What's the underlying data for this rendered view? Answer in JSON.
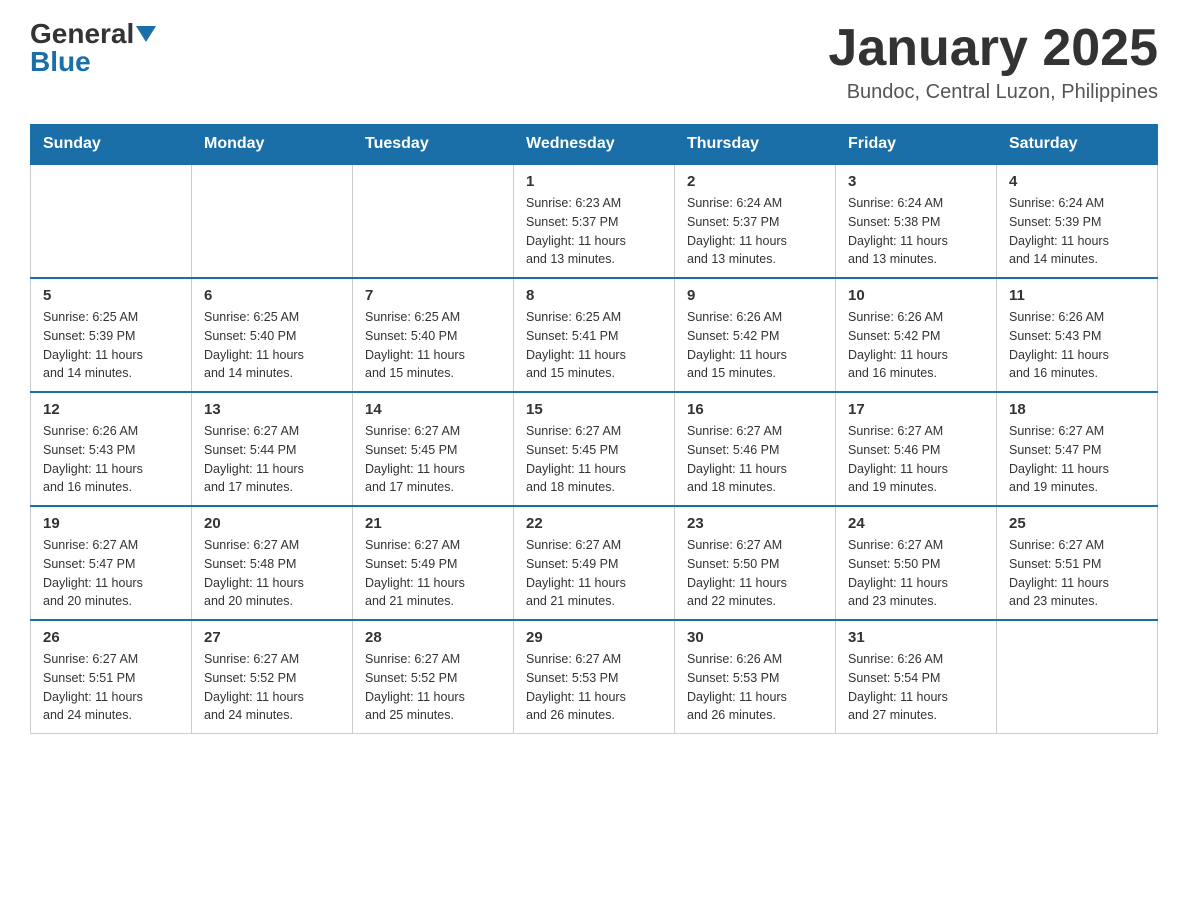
{
  "header": {
    "logo_general": "General",
    "logo_blue": "Blue",
    "month_title": "January 2025",
    "location": "Bundoc, Central Luzon, Philippines"
  },
  "days_of_week": [
    "Sunday",
    "Monday",
    "Tuesday",
    "Wednesday",
    "Thursday",
    "Friday",
    "Saturday"
  ],
  "weeks": [
    [
      {
        "day": "",
        "info": ""
      },
      {
        "day": "",
        "info": ""
      },
      {
        "day": "",
        "info": ""
      },
      {
        "day": "1",
        "info": "Sunrise: 6:23 AM\nSunset: 5:37 PM\nDaylight: 11 hours\nand 13 minutes."
      },
      {
        "day": "2",
        "info": "Sunrise: 6:24 AM\nSunset: 5:37 PM\nDaylight: 11 hours\nand 13 minutes."
      },
      {
        "day": "3",
        "info": "Sunrise: 6:24 AM\nSunset: 5:38 PM\nDaylight: 11 hours\nand 13 minutes."
      },
      {
        "day": "4",
        "info": "Sunrise: 6:24 AM\nSunset: 5:39 PM\nDaylight: 11 hours\nand 14 minutes."
      }
    ],
    [
      {
        "day": "5",
        "info": "Sunrise: 6:25 AM\nSunset: 5:39 PM\nDaylight: 11 hours\nand 14 minutes."
      },
      {
        "day": "6",
        "info": "Sunrise: 6:25 AM\nSunset: 5:40 PM\nDaylight: 11 hours\nand 14 minutes."
      },
      {
        "day": "7",
        "info": "Sunrise: 6:25 AM\nSunset: 5:40 PM\nDaylight: 11 hours\nand 15 minutes."
      },
      {
        "day": "8",
        "info": "Sunrise: 6:25 AM\nSunset: 5:41 PM\nDaylight: 11 hours\nand 15 minutes."
      },
      {
        "day": "9",
        "info": "Sunrise: 6:26 AM\nSunset: 5:42 PM\nDaylight: 11 hours\nand 15 minutes."
      },
      {
        "day": "10",
        "info": "Sunrise: 6:26 AM\nSunset: 5:42 PM\nDaylight: 11 hours\nand 16 minutes."
      },
      {
        "day": "11",
        "info": "Sunrise: 6:26 AM\nSunset: 5:43 PM\nDaylight: 11 hours\nand 16 minutes."
      }
    ],
    [
      {
        "day": "12",
        "info": "Sunrise: 6:26 AM\nSunset: 5:43 PM\nDaylight: 11 hours\nand 16 minutes."
      },
      {
        "day": "13",
        "info": "Sunrise: 6:27 AM\nSunset: 5:44 PM\nDaylight: 11 hours\nand 17 minutes."
      },
      {
        "day": "14",
        "info": "Sunrise: 6:27 AM\nSunset: 5:45 PM\nDaylight: 11 hours\nand 17 minutes."
      },
      {
        "day": "15",
        "info": "Sunrise: 6:27 AM\nSunset: 5:45 PM\nDaylight: 11 hours\nand 18 minutes."
      },
      {
        "day": "16",
        "info": "Sunrise: 6:27 AM\nSunset: 5:46 PM\nDaylight: 11 hours\nand 18 minutes."
      },
      {
        "day": "17",
        "info": "Sunrise: 6:27 AM\nSunset: 5:46 PM\nDaylight: 11 hours\nand 19 minutes."
      },
      {
        "day": "18",
        "info": "Sunrise: 6:27 AM\nSunset: 5:47 PM\nDaylight: 11 hours\nand 19 minutes."
      }
    ],
    [
      {
        "day": "19",
        "info": "Sunrise: 6:27 AM\nSunset: 5:47 PM\nDaylight: 11 hours\nand 20 minutes."
      },
      {
        "day": "20",
        "info": "Sunrise: 6:27 AM\nSunset: 5:48 PM\nDaylight: 11 hours\nand 20 minutes."
      },
      {
        "day": "21",
        "info": "Sunrise: 6:27 AM\nSunset: 5:49 PM\nDaylight: 11 hours\nand 21 minutes."
      },
      {
        "day": "22",
        "info": "Sunrise: 6:27 AM\nSunset: 5:49 PM\nDaylight: 11 hours\nand 21 minutes."
      },
      {
        "day": "23",
        "info": "Sunrise: 6:27 AM\nSunset: 5:50 PM\nDaylight: 11 hours\nand 22 minutes."
      },
      {
        "day": "24",
        "info": "Sunrise: 6:27 AM\nSunset: 5:50 PM\nDaylight: 11 hours\nand 23 minutes."
      },
      {
        "day": "25",
        "info": "Sunrise: 6:27 AM\nSunset: 5:51 PM\nDaylight: 11 hours\nand 23 minutes."
      }
    ],
    [
      {
        "day": "26",
        "info": "Sunrise: 6:27 AM\nSunset: 5:51 PM\nDaylight: 11 hours\nand 24 minutes."
      },
      {
        "day": "27",
        "info": "Sunrise: 6:27 AM\nSunset: 5:52 PM\nDaylight: 11 hours\nand 24 minutes."
      },
      {
        "day": "28",
        "info": "Sunrise: 6:27 AM\nSunset: 5:52 PM\nDaylight: 11 hours\nand 25 minutes."
      },
      {
        "day": "29",
        "info": "Sunrise: 6:27 AM\nSunset: 5:53 PM\nDaylight: 11 hours\nand 26 minutes."
      },
      {
        "day": "30",
        "info": "Sunrise: 6:26 AM\nSunset: 5:53 PM\nDaylight: 11 hours\nand 26 minutes."
      },
      {
        "day": "31",
        "info": "Sunrise: 6:26 AM\nSunset: 5:54 PM\nDaylight: 11 hours\nand 27 minutes."
      },
      {
        "day": "",
        "info": ""
      }
    ]
  ]
}
